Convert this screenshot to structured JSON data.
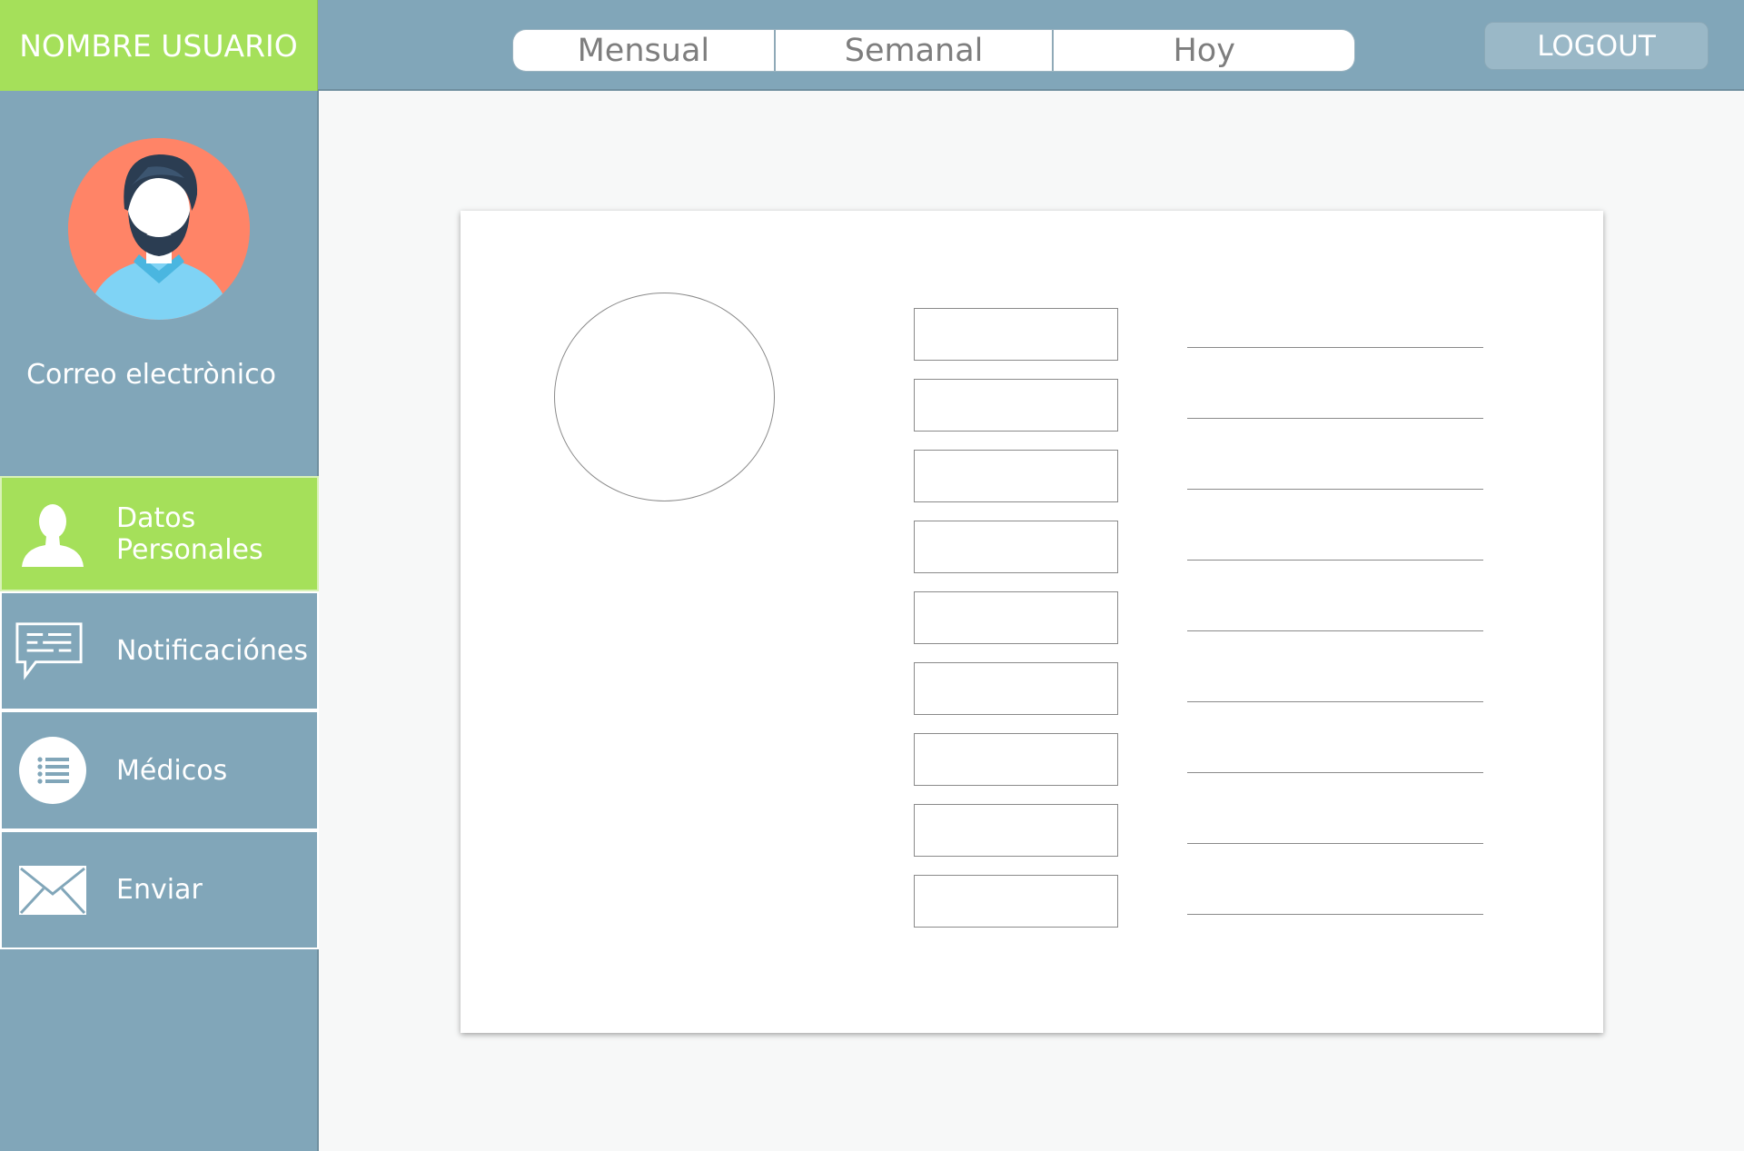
{
  "header": {
    "username": "NOMBRE USUARIO",
    "tabs": [
      {
        "label": "Mensual"
      },
      {
        "label": "Semanal"
      },
      {
        "label": "Hoy"
      }
    ],
    "logout_label": "LOGOUT"
  },
  "sidebar": {
    "email_label": "Correo electrònico",
    "items": [
      {
        "label": "Datos Personales",
        "icon": "person-icon",
        "active": true
      },
      {
        "label": "Notificaciónes",
        "icon": "chat-bubble-icon",
        "active": false
      },
      {
        "label": "Médicos",
        "icon": "list-icon",
        "active": false
      },
      {
        "label": "Enviar",
        "icon": "envelope-icon",
        "active": false
      }
    ]
  },
  "colors": {
    "accent_green": "#a5e05a",
    "nav_blue": "#81a6b9",
    "content_bg": "#f7f8f8",
    "avatar_bg": "#ff8467"
  },
  "form": {
    "field_count": 9
  }
}
